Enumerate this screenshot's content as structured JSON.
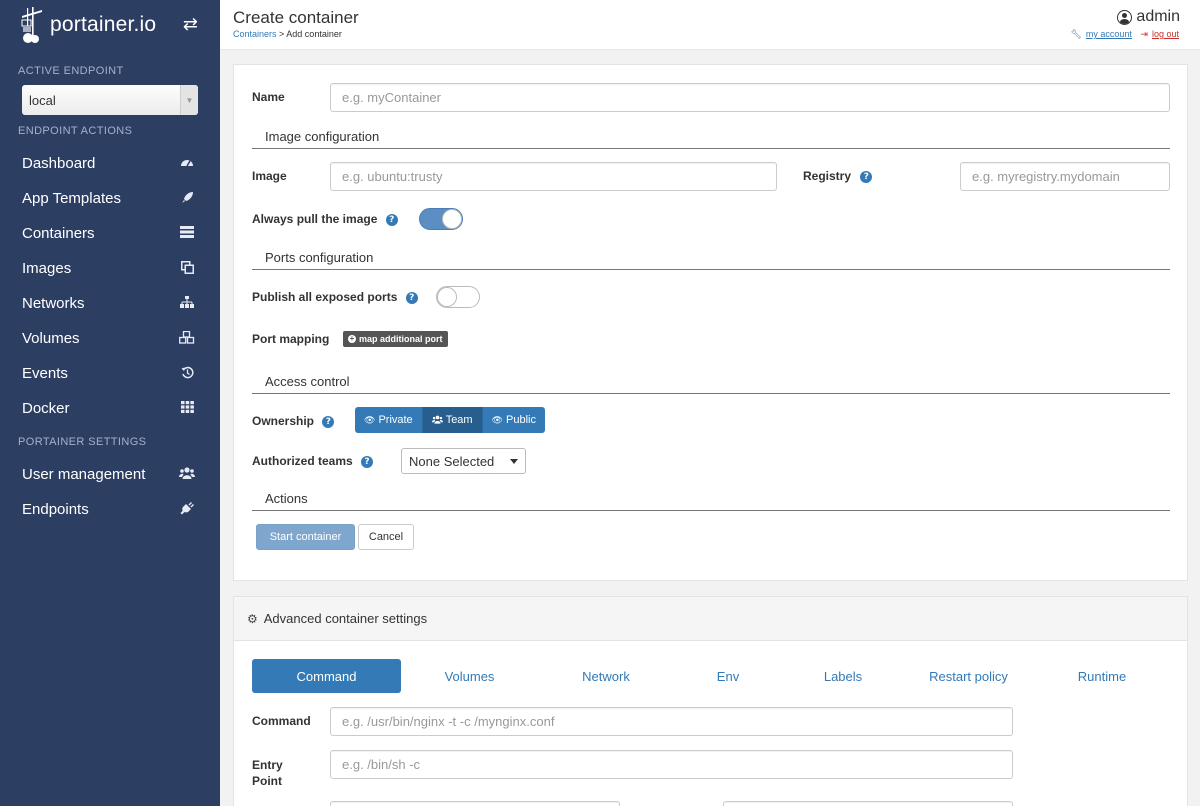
{
  "brand": {
    "name": "portainer.io"
  },
  "sidebar": {
    "active_endpoint_title": "ACTIVE ENDPOINT",
    "endpoint_value": "local",
    "endpoint_actions_title": "ENDPOINT ACTIONS",
    "items": [
      {
        "label": "Dashboard",
        "icon": "dashboard-icon"
      },
      {
        "label": "App Templates",
        "icon": "rocket-icon"
      },
      {
        "label": "Containers",
        "icon": "server-icon"
      },
      {
        "label": "Images",
        "icon": "clone-icon"
      },
      {
        "label": "Networks",
        "icon": "sitemap-icon"
      },
      {
        "label": "Volumes",
        "icon": "cubes-icon"
      },
      {
        "label": "Events",
        "icon": "history-icon"
      },
      {
        "label": "Docker",
        "icon": "th-icon"
      }
    ],
    "portainer_settings_title": "PORTAINER SETTINGS",
    "settings_items": [
      {
        "label": "User management",
        "icon": "users-icon"
      },
      {
        "label": "Endpoints",
        "icon": "plug-icon"
      }
    ]
  },
  "header": {
    "title": "Create container",
    "breadcrumb_link": "Containers",
    "breadcrumb_sep": " > ",
    "breadcrumb_current": "Add container",
    "user": "admin",
    "my_account": "my account",
    "log_out": "log out"
  },
  "form": {
    "name_label": "Name",
    "name_placeholder": "e.g. myContainer",
    "image_config_title": "Image configuration",
    "image_label": "Image",
    "image_placeholder": "e.g. ubuntu:trusty",
    "registry_label": "Registry",
    "registry_placeholder": "e.g. myregistry.mydomain",
    "always_pull_label": "Always pull the image",
    "always_pull_on": true,
    "ports_config_title": "Ports configuration",
    "publish_ports_label": "Publish all exposed ports",
    "publish_ports_on": false,
    "port_mapping_label": "Port mapping",
    "map_port_button": "map additional port",
    "access_control_title": "Access control",
    "ownership_label": "Ownership",
    "ownership_options": [
      "Private",
      "Team",
      "Public"
    ],
    "ownership_selected": "Team",
    "authorized_teams_label": "Authorized teams",
    "authorized_teams_value": "None Selected",
    "actions_title": "Actions",
    "start_button": "Start container",
    "cancel_button": "Cancel"
  },
  "advanced": {
    "title": "Advanced container settings",
    "tabs": [
      "Command",
      "Volumes",
      "Network",
      "Env",
      "Labels",
      "Restart policy",
      "Runtime"
    ],
    "active_tab": "Command",
    "command_label": "Command",
    "command_placeholder": "e.g. /usr/bin/nginx -t -c /mynginx.conf",
    "entry_label_line1": "Entry",
    "entry_label_line2": "Point",
    "entry_placeholder": "e.g. /bin/sh -c"
  }
}
